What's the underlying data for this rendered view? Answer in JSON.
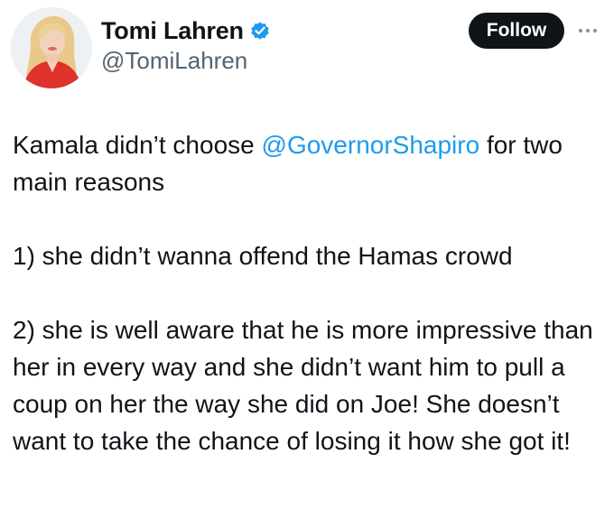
{
  "user": {
    "display_name": "Tomi Lahren",
    "handle": "@TomiLahren",
    "verified_icon": "verified-badge-icon",
    "verified_color": "#1d9bf0"
  },
  "actions": {
    "follow_label": "Follow",
    "more_icon": "more-dots-icon"
  },
  "tweet": {
    "intro_before_mention": "Kamala didn’t choose ",
    "mention": "@GovernorShapiro",
    "intro_after_mention": " for two main reasons",
    "point_1": "1) she didn’t wanna offend the Hamas crowd",
    "point_2": "2) she is well aware that he is more impressive than her in every way and she didn’t want him to pull a coup on her the way she did on Joe! She doesn’t want to take the chance of losing it how she got it!"
  },
  "colors": {
    "text": "#0f1419",
    "secondary": "#536471",
    "link": "#1d9bf0",
    "button_bg": "#0f1419"
  }
}
